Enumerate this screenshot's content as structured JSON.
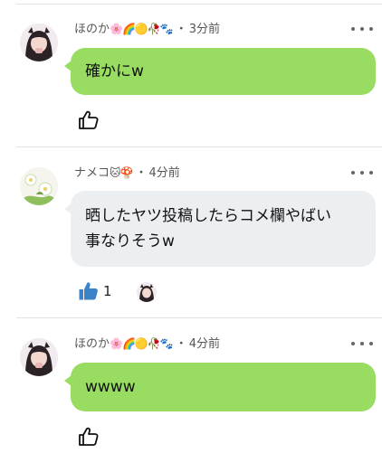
{
  "comments": [
    {
      "username": "ほのか",
      "name_emoji": "🌸🌈🟡🥀🐾",
      "separator": "・",
      "time": "3分前",
      "text": "確かにw",
      "bubble_color": "#98dd62",
      "like_icon": "thumbs-up-outline-icon",
      "avatar": "dark-hair-girl-avatar"
    },
    {
      "username": "ナメコ",
      "name_emoji": "🐱🍄",
      "separator": "・",
      "time": "4分前",
      "text_line1": "晒したヤツ投稿したらコメ欄やばい",
      "text_line2": "事なりそうw",
      "bubble_color": "#eceff2",
      "like_icon": "thumbs-up-filled-icon",
      "like_color": "#3b83c9",
      "like_count": "1",
      "avatar": "flower-avatar"
    },
    {
      "username": "ほのか",
      "name_emoji": "🌸🌈🟡🥀🐾",
      "separator": "・",
      "time": "4分前",
      "text": "wwww",
      "bubble_color": "#98dd62",
      "like_icon": "thumbs-up-outline-icon",
      "avatar": "dark-hair-girl-avatar"
    }
  ]
}
